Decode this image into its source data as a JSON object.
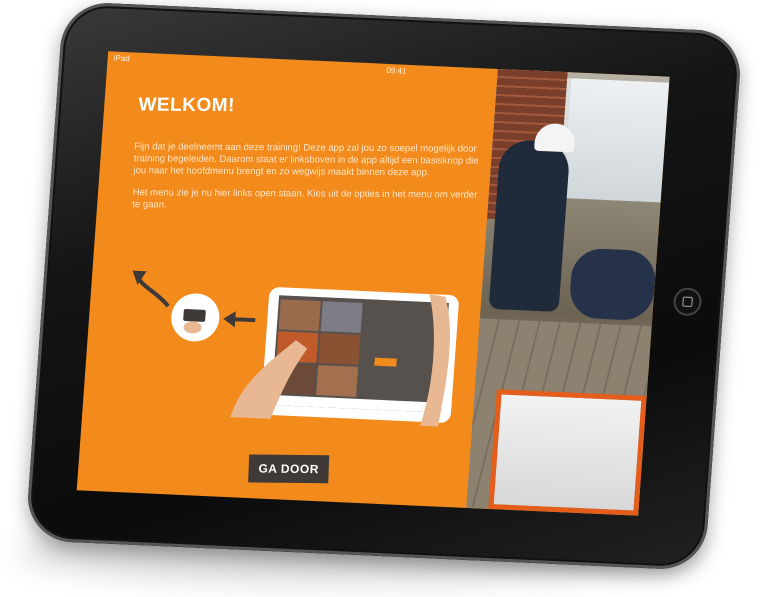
{
  "statusbar": {
    "left": "iPad",
    "time": "09:41"
  },
  "screen": {
    "title": "WELKOM!",
    "intro_p1": "Fijn dat je deelneemt aan deze training! Deze app zal jou zo soepel mogelijk door training begeleiden. Daarom staat er linksboven in de app altijd een basisknop die jou naar het hoofdmenu brengt en zo wegwijs maakt binnen deze app.",
    "intro_p2": "Het menu zie je nu hier links open staan. Kies uit de opties in het menu om verder te gaan.",
    "cta_label": "GA DOOR"
  },
  "colors": {
    "orange": "#f28a1c",
    "dark_button": "#3f3a37",
    "bezel": "#151515"
  },
  "icons": [
    "back-arrow-icon",
    "menu-button-circle-icon",
    "left-arrow-icon"
  ]
}
